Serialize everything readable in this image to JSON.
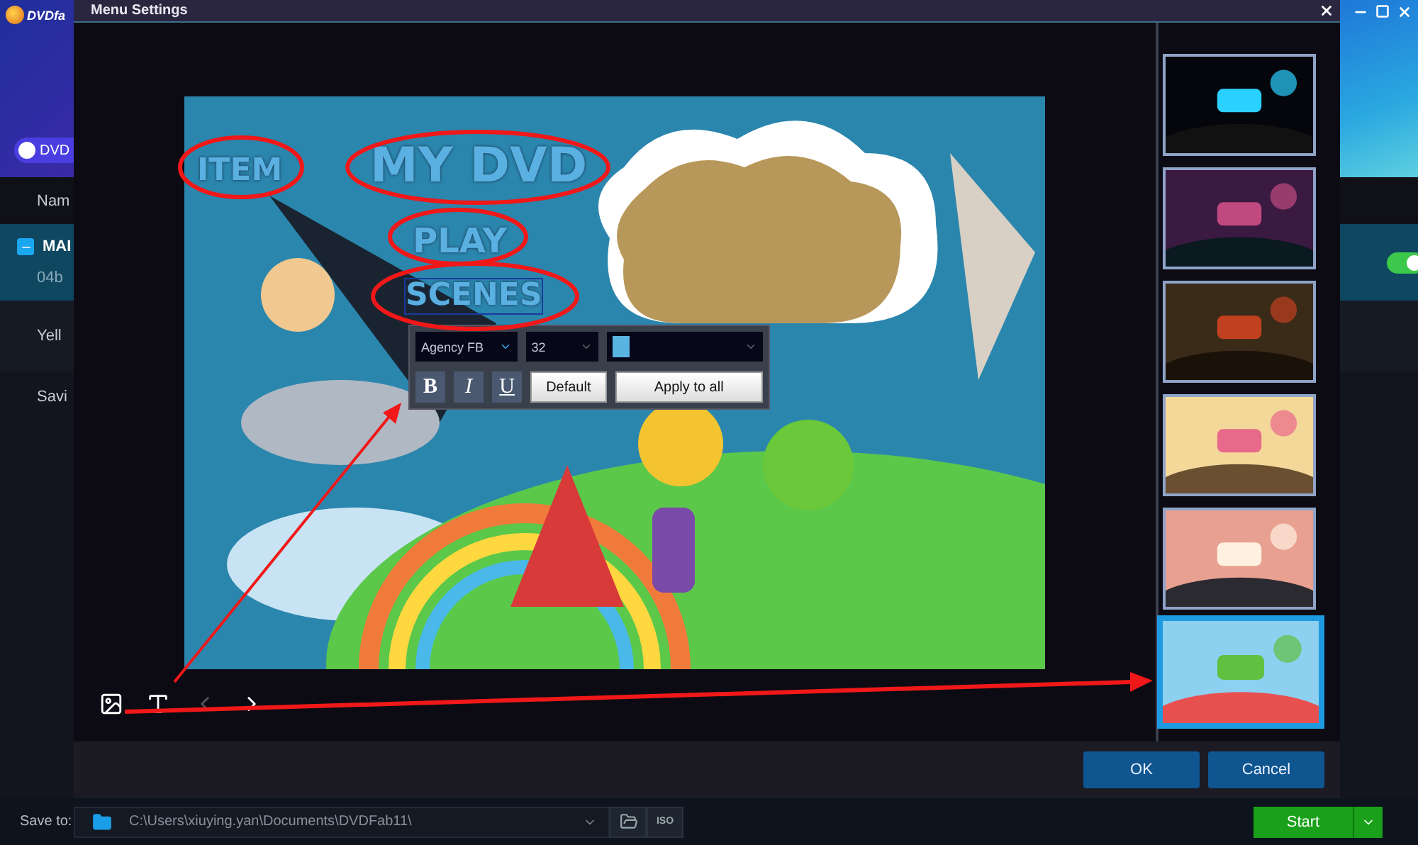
{
  "app": {
    "logo_text": "DVDfa",
    "source_button": "DVD",
    "column_header": "Nam",
    "title_row": "MAI",
    "title_sub": "04b",
    "audio_row": "Yell",
    "subtitle_row": "Savi",
    "toggle_on": true
  },
  "dialog": {
    "title": "Menu Settings",
    "menu_texts": [
      {
        "kind": "item",
        "text": "ITEM",
        "selected": false
      },
      {
        "kind": "title",
        "text": "MY DVD",
        "selected": false
      },
      {
        "kind": "play",
        "text": "PLAY",
        "selected": false
      },
      {
        "kind": "scenes",
        "text": "SCENES",
        "selected": true
      }
    ],
    "font_toolbar": {
      "font": "Agency FB",
      "size": "32",
      "color": "#5ab4e0",
      "style_buttons": [
        "B",
        "I",
        "U"
      ],
      "default_button": "Default",
      "apply_button": "Apply to all"
    },
    "thumbnails": [
      {
        "kind": "dark",
        "selected": false
      },
      {
        "kind": "galaxy",
        "selected": false
      },
      {
        "kind": "film",
        "selected": false
      },
      {
        "kind": "cake",
        "selected": false
      },
      {
        "kind": "wedding",
        "selected": false
      },
      {
        "kind": "kids",
        "selected": true
      }
    ],
    "buttons": [
      "OK",
      "Cancel"
    ]
  },
  "bottom_bar": {
    "label": "Save to:",
    "path": "C:\\Users\\xiuying.yan\\Documents\\DVDFab11\\",
    "iso": "ISO",
    "start": "Start"
  }
}
